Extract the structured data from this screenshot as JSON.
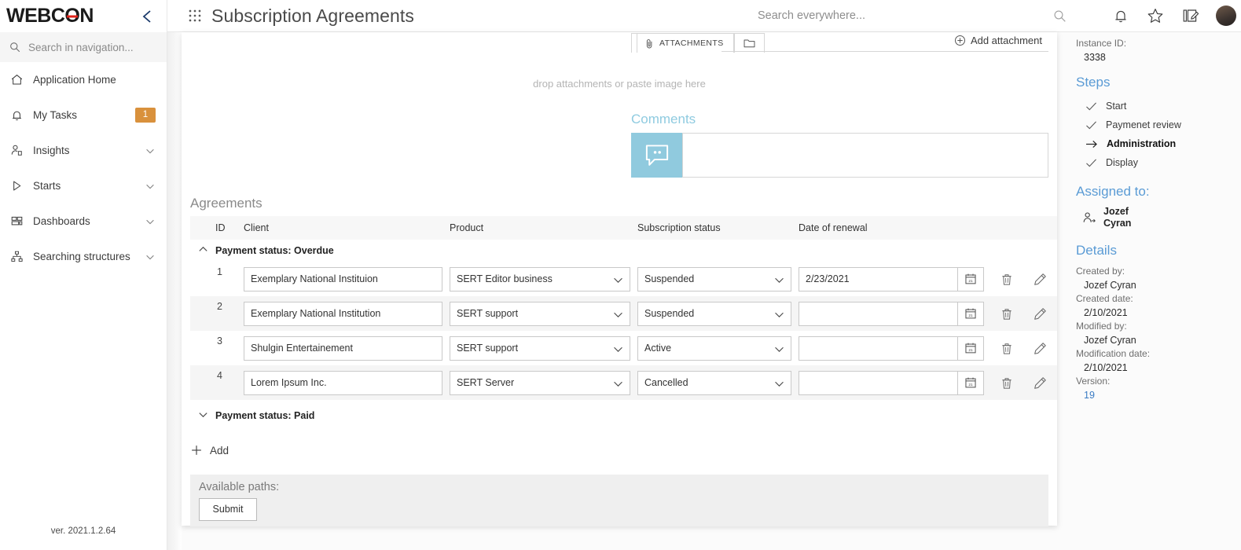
{
  "brand": {
    "name": "WEBCON",
    "collapse_icon": "chevron-left-icon"
  },
  "sidebar": {
    "search_placeholder": "Search in navigation...",
    "items": [
      {
        "label": "Application Home",
        "icon": "home-icon",
        "badge": null,
        "expandable": false
      },
      {
        "label": "My Tasks",
        "icon": "bell-icon",
        "badge": "1",
        "expandable": false
      },
      {
        "label": "Insights",
        "icon": "person-insights-icon",
        "badge": null,
        "expandable": true
      },
      {
        "label": "Starts",
        "icon": "play-triangle-icon",
        "badge": null,
        "expandable": true
      },
      {
        "label": "Dashboards",
        "icon": "dashboard-grid-icon",
        "badge": null,
        "expandable": true
      },
      {
        "label": "Searching structures",
        "icon": "hierarchy-icon",
        "badge": null,
        "expandable": true
      }
    ],
    "version": "ver. 2021.1.2.64",
    "badge_color": "#d9913c"
  },
  "topbar": {
    "waffle_icon": "app-grid-icon",
    "title": "Subscription Agreements",
    "search_placeholder": "Search everywhere...",
    "search_value": "",
    "icons": [
      "search-icon",
      "bell-icon",
      "star-icon",
      "notes-edit-icon",
      "user-avatar"
    ]
  },
  "attachments": {
    "tab_label": "ATTACHMENTS",
    "tab_icon": "paperclip-icon",
    "folder_icon": "folder-icon",
    "folder_value": "",
    "add_label": "Add attachment",
    "add_icon": "plus-circle-icon",
    "drop_hint": "drop attachments or paste image here"
  },
  "comments": {
    "title": "Comments",
    "icon": "comment-bubble-icon",
    "value": "",
    "placeholder": "",
    "accent": "#90cade"
  },
  "agreements": {
    "title": "Agreements",
    "columns": [
      "ID",
      "Client",
      "Product",
      "Subscription status",
      "Date of renewal"
    ],
    "groups": [
      {
        "label": "Payment status: Overdue",
        "expanded": true,
        "chevron": "chevron-up-icon",
        "rows": [
          {
            "id": "1",
            "client": "Exemplary National Instituion",
            "product": "SERT Editor business",
            "status": "Suspended",
            "date": "2/23/2021"
          },
          {
            "id": "2",
            "client": "Exemplary National Institution",
            "product": "SERT support",
            "status": "Suspended",
            "date": ""
          },
          {
            "id": "3",
            "client": "Shulgin Entertainement",
            "product": "SERT support",
            "status": "Active",
            "date": ""
          },
          {
            "id": "4",
            "client": "Lorem Ipsum Inc.",
            "product": "SERT Server",
            "status": "Cancelled",
            "date": ""
          }
        ]
      },
      {
        "label": "Payment status: Paid",
        "expanded": false,
        "chevron": "chevron-down-icon",
        "rows": []
      }
    ],
    "row_icons": {
      "calendar": "calendar-icon",
      "delete": "trash-icon",
      "edit": "pencil-icon"
    },
    "add_label": "Add",
    "add_icon": "plus-icon"
  },
  "paths": {
    "label": "Available paths:",
    "submit_label": "Submit"
  },
  "details_panel": {
    "instance_id_label": "Instance ID:",
    "instance_id_value": "3338",
    "steps_title": "Steps",
    "steps": [
      {
        "label": "Start",
        "icon": "check-icon",
        "active": false
      },
      {
        "label": "Paymenet review",
        "icon": "check-icon",
        "active": false
      },
      {
        "label": "Administration",
        "icon": "arrow-right-icon",
        "active": true
      },
      {
        "label": "Display",
        "icon": "check-icon",
        "active": false
      }
    ],
    "assigned_title": "Assigned to:",
    "assigned_icon": "person-arrow-icon",
    "assigned_first": "Jozef",
    "assigned_last": "Cyran",
    "details_title": "Details",
    "fields": [
      {
        "key": "Created by:",
        "value": "Jozef Cyran",
        "link": false
      },
      {
        "key": "Created date:",
        "value": "2/10/2021",
        "link": false
      },
      {
        "key": "Modified by:",
        "value": "Jozef Cyran",
        "link": false
      },
      {
        "key": "Modification date:",
        "value": "2/10/2021",
        "link": false
      },
      {
        "key": "Version:",
        "value": "19",
        "link": true
      }
    ],
    "heading_color": "#5a9bd5"
  }
}
